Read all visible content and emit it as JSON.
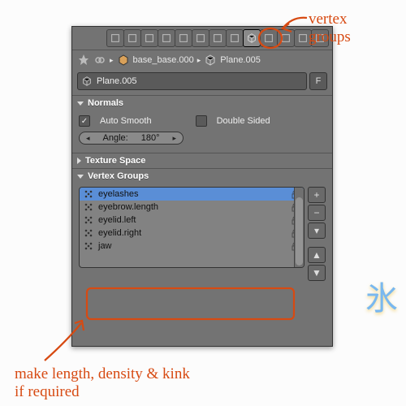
{
  "header": {
    "icons": [
      "render-icon",
      "camera-icon",
      "mesh-icon",
      "curve-icon",
      "armature-icon",
      "bone-icon",
      "constraint-icon",
      "modifier-icon",
      "object-data-icon",
      "material-icon",
      "texture-icon",
      "particles-icon",
      "physics-icon"
    ],
    "active_icon": "object-data-icon"
  },
  "breadcrumb": {
    "pin_icon": "pin-icon",
    "chain_icon": "link-icon",
    "obj_icon": "mesh-icon",
    "obj_name": "base_base.000",
    "data_icon": "object-data-icon",
    "data_name": "Plane.005"
  },
  "name_field": {
    "icon": "object-data-icon",
    "value": "Plane.005",
    "f_button": "F"
  },
  "sections": {
    "normals": {
      "title": "Normals",
      "auto_smooth": {
        "checked": true,
        "label": "Auto Smooth"
      },
      "double_sided": {
        "checked": false,
        "label": "Double Sided"
      },
      "angle_label": "Angle:",
      "angle_value": "180°"
    },
    "texture_space": {
      "title": "Texture Space"
    },
    "vertex_groups": {
      "title": "Vertex Groups",
      "items": [
        {
          "name": "jaw",
          "selected": false
        },
        {
          "name": "eyelid.right",
          "selected": false
        },
        {
          "name": "eyelid.left",
          "selected": false
        },
        {
          "name": "eyebrow.length",
          "selected": false
        },
        {
          "name": "eyelashes",
          "selected": true
        }
      ],
      "side_buttons": [
        "+",
        "−",
        "▾",
        "▲",
        "▼"
      ]
    }
  },
  "annotations": {
    "top": "vertex\ngroups",
    "bottom": "make length, density & kink\nif required"
  }
}
